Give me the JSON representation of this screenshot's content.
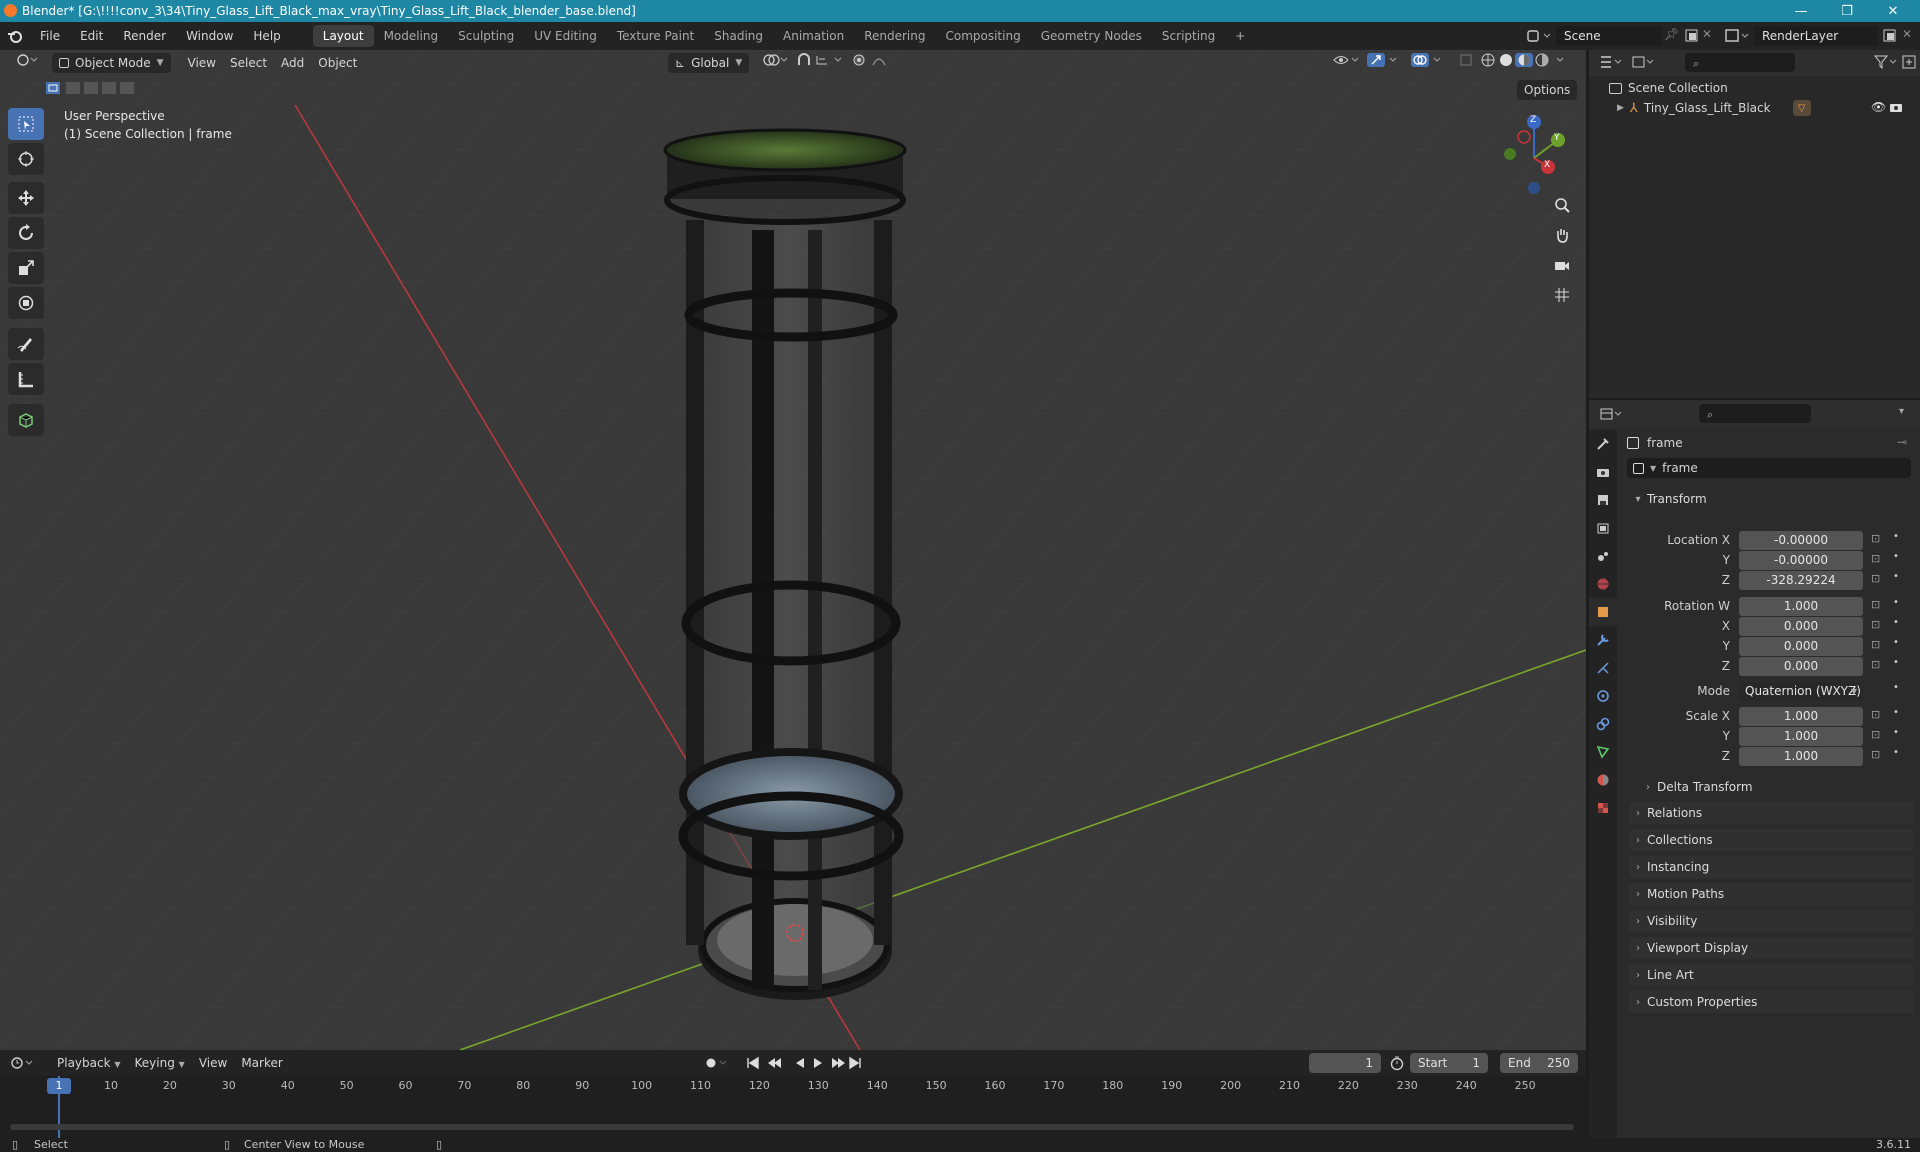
{
  "window": {
    "title": "Blender* [G:\\!!!!conv_3\\34\\Tiny_Glass_Lift_Black_max_vray\\Tiny_Glass_Lift_Black_blender_base.blend]",
    "minimize": "—",
    "maximize": "❐",
    "close": "✕"
  },
  "menu": {
    "items": [
      "File",
      "Edit",
      "Render",
      "Window",
      "Help"
    ],
    "workspaces": [
      "Layout",
      "Modeling",
      "Sculpting",
      "UV Editing",
      "Texture Paint",
      "Shading",
      "Animation",
      "Rendering",
      "Compositing",
      "Geometry Nodes",
      "Scripting"
    ],
    "add_workspace": "+",
    "scene": "Scene",
    "render_layer": "RenderLayer"
  },
  "viewport": {
    "mode": "Object Mode",
    "menus": [
      "View",
      "Select",
      "Add",
      "Object"
    ],
    "orientation": "Global",
    "options": "Options",
    "perspective": "User Perspective",
    "collection_info": "(1) Scene Collection | frame",
    "gizmo": {
      "x": "X",
      "y": "Y",
      "z": "Z"
    }
  },
  "outliner": {
    "search_placeholder": "",
    "root": "Scene Collection",
    "items": [
      {
        "name": "Tiny_Glass_Lift_Black"
      }
    ]
  },
  "properties": {
    "object_name": "frame",
    "data_name": "frame",
    "transform_label": "Transform",
    "location": {
      "label_x": "Location X",
      "label_y": "Y",
      "label_z": "Z",
      "x": "-0.00000",
      "y": "-0.00000",
      "z": "-328.29224"
    },
    "rotation": {
      "label_w": "Rotation W",
      "label_x": "X",
      "label_y": "Y",
      "label_z": "Z",
      "w": "1.000",
      "x": "0.000",
      "y": "0.000",
      "z": "0.000"
    },
    "mode_label": "Mode",
    "mode_value": "Quaternion (WXYZ)",
    "scale": {
      "label_x": "Scale X",
      "label_y": "Y",
      "label_z": "Z",
      "x": "1.000",
      "y": "1.000",
      "z": "1.000"
    },
    "delta_transform": "Delta Transform",
    "panels": [
      "Relations",
      "Collections",
      "Instancing",
      "Motion Paths",
      "Visibility",
      "Viewport Display",
      "Line Art",
      "Custom Properties"
    ]
  },
  "timeline": {
    "menus": [
      "Playback",
      "Keying",
      "View",
      "Marker"
    ],
    "current_frame": "1",
    "start_label": "Start",
    "start": "1",
    "end_label": "End",
    "end": "250",
    "ticks": [
      "1",
      "10",
      "20",
      "30",
      "40",
      "50",
      "60",
      "70",
      "80",
      "90",
      "100",
      "110",
      "120",
      "130",
      "140",
      "150",
      "160",
      "170",
      "180",
      "190",
      "200",
      "210",
      "220",
      "230",
      "240",
      "250"
    ]
  },
  "status": {
    "select": "Select",
    "center_view": "Center View to Mouse",
    "version": "3.6.11"
  }
}
